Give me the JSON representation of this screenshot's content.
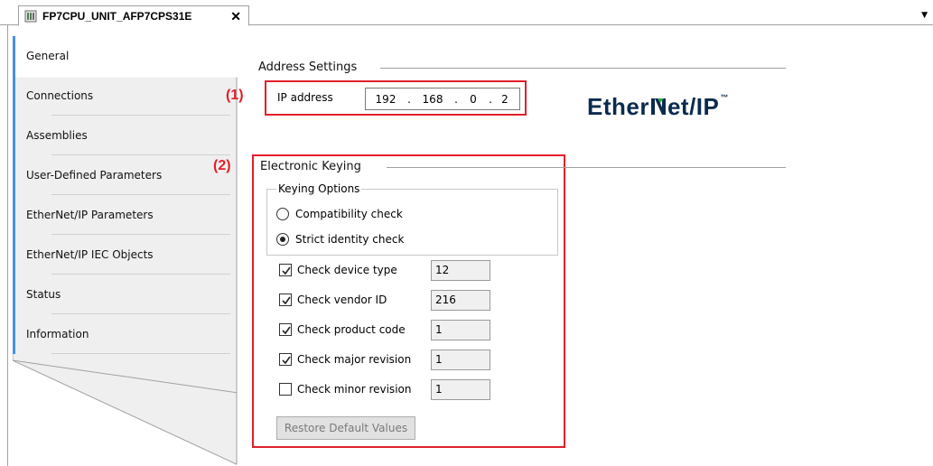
{
  "tab": {
    "title": "FP7CPU_UNIT_AFP7CPS31E",
    "close": "✕",
    "dropdown": "▼"
  },
  "sidebar": {
    "items": [
      {
        "label": "General"
      },
      {
        "label": "Connections"
      },
      {
        "label": "Assemblies"
      },
      {
        "label": "User-Defined Parameters"
      },
      {
        "label": "EtherNet/IP Parameters"
      },
      {
        "label": "EtherNet/IP IEC Objects"
      },
      {
        "label": "Status"
      },
      {
        "label": "Information"
      }
    ],
    "active_index": 0
  },
  "address": {
    "title": "Address Settings",
    "annotation": "(1)",
    "ip_label": "IP address",
    "ip": [
      "192",
      "168",
      "0",
      "2"
    ],
    "dot": "."
  },
  "logo": {
    "text_a": "Ether",
    "text_b": "et/IP",
    "tm": "™"
  },
  "keying": {
    "title": "Electronic Keying",
    "annotation": "(2)",
    "options_title": "Keying Options",
    "options": [
      {
        "label": "Compatibility check",
        "selected": false
      },
      {
        "label": "Strict identity check",
        "selected": true
      }
    ],
    "checks": [
      {
        "label": "Check device type",
        "checked": true,
        "value": "12"
      },
      {
        "label": "Check vendor ID",
        "checked": true,
        "value": "216"
      },
      {
        "label": "Check product code",
        "checked": true,
        "value": "1"
      },
      {
        "label": "Check major revision",
        "checked": true,
        "value": "1"
      },
      {
        "label": "Check minor revision",
        "checked": false,
        "value": "1"
      }
    ],
    "restore_label": "Restore Default Values"
  },
  "colors": {
    "annotation_red": "#e0202a",
    "accent_blue": "#4a90e2",
    "logo_navy": "#0b2b4e"
  }
}
